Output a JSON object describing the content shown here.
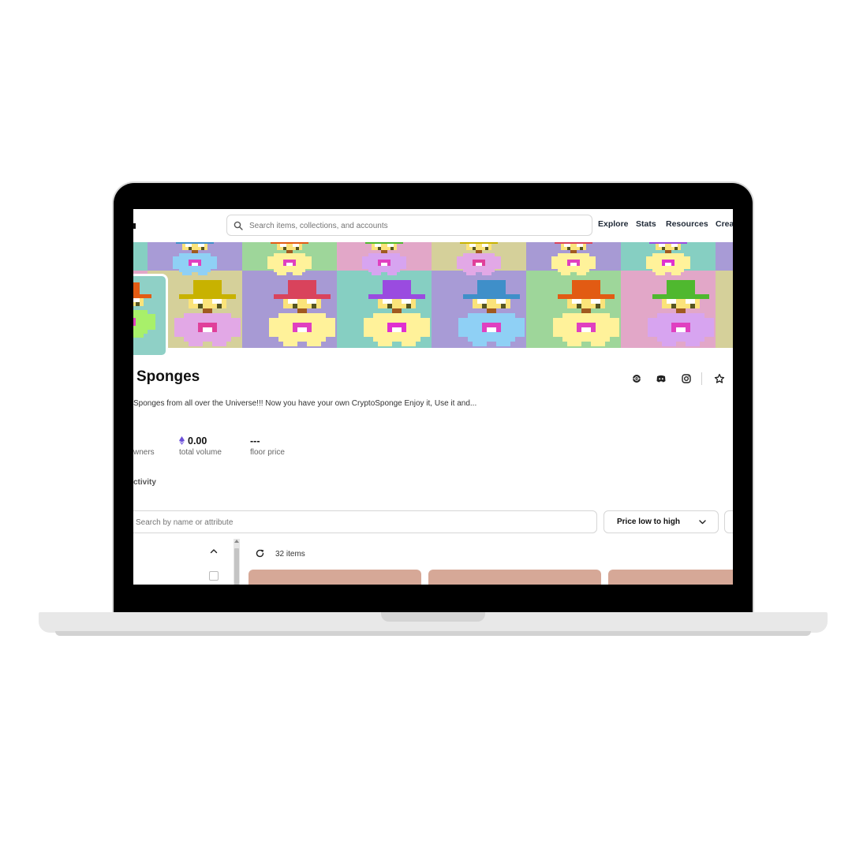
{
  "header": {
    "search_placeholder": "Search items, collections, and accounts",
    "nav": [
      "Explore",
      "Stats",
      "Resources",
      "Crea"
    ]
  },
  "banner": {
    "tiles": [
      {
        "bg": "#d5d09a",
        "hat": "#c8b200",
        "body": "#e2a8e6",
        "mouth": "#e0409a"
      },
      {
        "bg": "#a79ad4",
        "hat": "#d9435c",
        "body": "#fff29a",
        "mouth": "#e040c0"
      },
      {
        "bg": "#86cfc2",
        "hat": "#9a4be0",
        "body": "#fff29a",
        "mouth": "#e030d0"
      },
      {
        "bg": "#a89bd6",
        "hat": "#3f8fc9",
        "body": "#8fd0f5",
        "mouth": "#e040c0"
      },
      {
        "bg": "#9ed69a",
        "hat": "#e25b13",
        "body": "#fff29a",
        "mouth": "#e040c0"
      },
      {
        "bg": "#e2a7c8",
        "hat": "#4fb82f",
        "body": "#d7a4f0",
        "mouth": "#e040c0"
      }
    ]
  },
  "collection": {
    "name": "Sponges",
    "description": "Sponges from all over the Universe!!! Now you have your own CryptoSponge Enjoy it, Use it and..."
  },
  "stats": {
    "owners_label": "wners",
    "volume_value": "0.00",
    "volume_label": "total volume",
    "floor_value": "---",
    "floor_label": "floor price"
  },
  "tabs": {
    "activity_fragment": "ctivity"
  },
  "filters": {
    "search_placeholder": "Search by name or attribute",
    "sort_label": "Price low to high"
  },
  "results": {
    "count_label": "32 items"
  },
  "colors": {
    "card": "#d6a897",
    "text": "#111111",
    "eth": "#6b4fd8"
  }
}
